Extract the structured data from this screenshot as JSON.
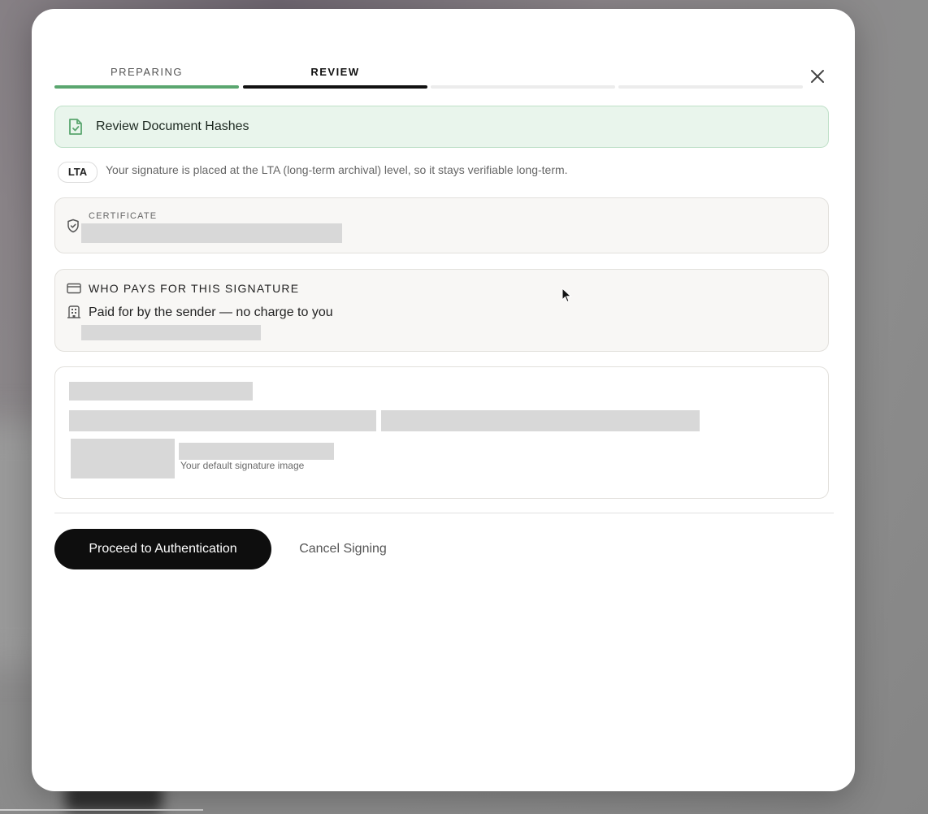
{
  "steps": [
    {
      "label": "PREPARING",
      "state": "done"
    },
    {
      "label": "REVIEW",
      "state": "active"
    },
    {
      "label": "",
      "state": "pending"
    },
    {
      "label": "",
      "state": "pending"
    }
  ],
  "banner": {
    "title": "Review Document Hashes",
    "icon": "file-check-icon"
  },
  "lta": {
    "badge": "LTA",
    "description": "Your signature is placed at the LTA (long-term archival) level, so it stays verifiable long-term."
  },
  "certificate": {
    "caption": "CERTIFICATE",
    "icon": "shield-check-icon"
  },
  "payment": {
    "heading": "WHO PAYS FOR THIS SIGNATURE",
    "detail": "Paid for by the sender — no charge to you",
    "heading_icon": "credit-card-icon",
    "detail_icon": "building-icon"
  },
  "signature": {
    "image_caption": "Your default signature image"
  },
  "actions": {
    "proceed": "Proceed to Authentication",
    "cancel": "Cancel Signing"
  },
  "colors": {
    "accent_green": "#5aa66f",
    "banner_bg": "#e9f5ec",
    "primary_button": "#0e0e0e"
  }
}
